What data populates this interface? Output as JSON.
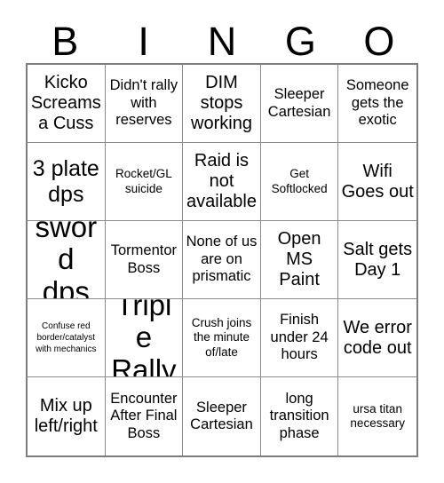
{
  "card": {
    "title_letters": [
      "B",
      "I",
      "N",
      "G",
      "O"
    ],
    "columns": 5,
    "rows": 5,
    "border_color": "#7d7d7d",
    "grid_line_color": "#8a8a8a",
    "text_color": "#000000",
    "background_color": "#ffffff"
  },
  "cells": [
    {
      "text": "Kicko Screams a Cuss",
      "size": "fs-lg"
    },
    {
      "text": "Didn't rally with reserves",
      "size": "fs-md"
    },
    {
      "text": "DIM stops working",
      "size": "fs-lg"
    },
    {
      "text": "Sleeper Cartesian",
      "size": "fs-md"
    },
    {
      "text": "Someone gets the exotic",
      "size": "fs-md"
    },
    {
      "text": "3 plate dps",
      "size": "fs-xl"
    },
    {
      "text": "Rocket/GL suicide",
      "size": "fs-sm"
    },
    {
      "text": "Raid is not available",
      "size": "fs-lg"
    },
    {
      "text": "Get Softlocked",
      "size": "fs-sm"
    },
    {
      "text": "Wifi Goes out",
      "size": "fs-lg"
    },
    {
      "text": "sword dps",
      "size": "fs-xxl"
    },
    {
      "text": "Tormentor Boss",
      "size": "fs-md"
    },
    {
      "text": "None of us are on prismatic",
      "size": "fs-md"
    },
    {
      "text": "Open MS Paint",
      "size": "fs-lg"
    },
    {
      "text": "Salt gets Day 1",
      "size": "fs-lg"
    },
    {
      "text": "Confuse red border/catalyst with mechanics",
      "size": "fs-xs"
    },
    {
      "text": "Triple Rally",
      "size": "fs-xxl"
    },
    {
      "text": "Crush joins the minute of/late",
      "size": "fs-sm"
    },
    {
      "text": "Finish under 24 hours",
      "size": "fs-md"
    },
    {
      "text": "We error code out",
      "size": "fs-lg"
    },
    {
      "text": "Mix up left/right",
      "size": "fs-lg"
    },
    {
      "text": "Encounter After Final Boss",
      "size": "fs-md"
    },
    {
      "text": "Sleeper Cartesian",
      "size": "fs-md"
    },
    {
      "text": "long transition phase",
      "size": "fs-md"
    },
    {
      "text": "ursa titan necessary",
      "size": "fs-sm"
    }
  ]
}
